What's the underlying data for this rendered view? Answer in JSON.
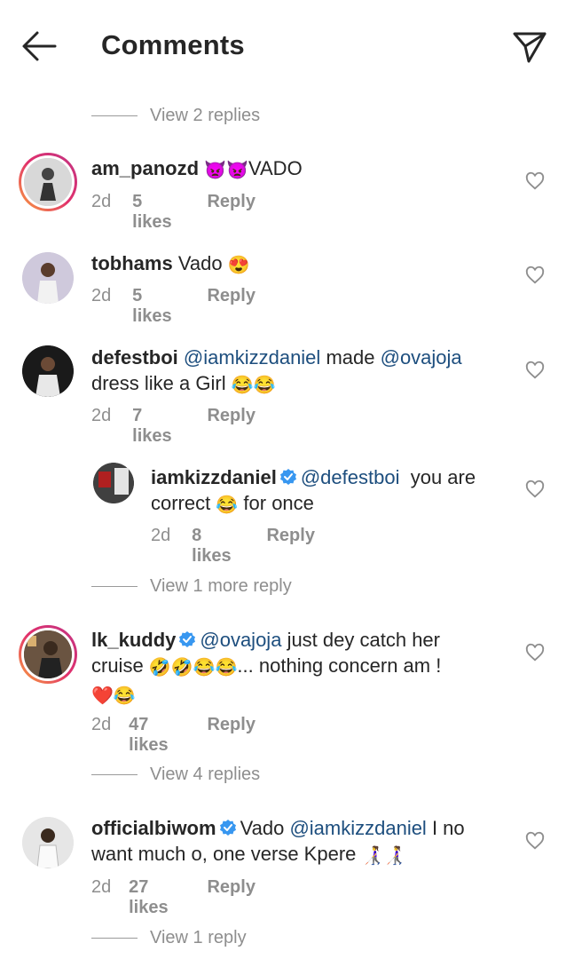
{
  "header": {
    "title": "Comments"
  },
  "view_links": {
    "v1": "View 2 replies",
    "v2": "View 1 more reply",
    "v3": "View 4 replies",
    "v4": "View 1 reply"
  },
  "comments": [
    {
      "username": "am_panozd",
      "text_a": "👿👿",
      "text_b": "VADO",
      "time": "2d",
      "likes": "5 likes",
      "reply": "Reply"
    },
    {
      "username": "tobhams",
      "text_a": "Vado",
      "text_b": "😍",
      "time": "2d",
      "likes": "5 likes",
      "reply": "Reply"
    },
    {
      "username": "defestboi",
      "mention1": "@iamkizzdaniel",
      "text_a": "made",
      "mention2": "@ovajoja",
      "text_b": "dress like a Girl",
      "emoji": "😂😂",
      "time": "2d",
      "likes": "7 likes",
      "reply": "Reply"
    },
    {
      "username": "iamkizzdaniel",
      "mention1": "@defestboi",
      "text_a": "you are",
      "text_b": "correct",
      "emoji": "😂",
      "text_c": "for once",
      "time": "2d",
      "likes": "8 likes",
      "reply": "Reply"
    },
    {
      "username": "lk_kuddy",
      "mention1": "@ovajoja",
      "text_a": "just dey catch her",
      "text_b": "cruise",
      "emoji": "🤣🤣😂😂",
      "text_c": "... nothing concern am !",
      "emoji2": "❤️😂",
      "time": "2d",
      "likes": "47 likes",
      "reply": "Reply"
    },
    {
      "username": "officialbiwom",
      "text_a": "Vado",
      "mention1": "@iamkizzdaniel",
      "text_b": "I no",
      "text_c": "want much o, one verse Kpere",
      "emoji": "👩‍🦯👩‍🦯",
      "time": "2d",
      "likes": "27 likes",
      "reply": "Reply"
    }
  ],
  "colors": {
    "mention": "#1d4e7e",
    "muted": "#8e8e8e",
    "verified": "#3897f0"
  }
}
